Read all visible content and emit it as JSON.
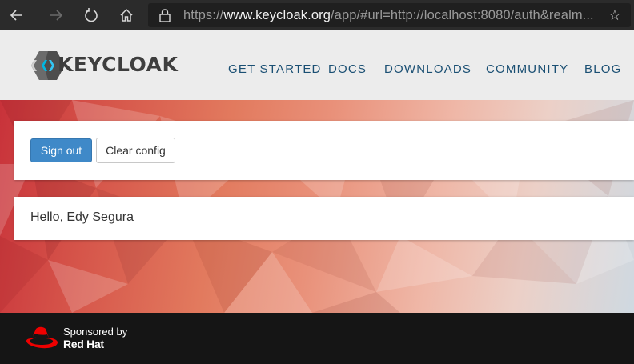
{
  "browser": {
    "url_prefix": "https://",
    "url_domain": "www.keycloak.org",
    "url_rest": "/app/#url=http://localhost:8080/auth&realm...",
    "icons": [
      "back-icon",
      "forward-icon",
      "refresh-icon",
      "home-icon",
      "lock-icon",
      "star-icon"
    ]
  },
  "header": {
    "logo_text": "KEYCLOAK",
    "nav": [
      "GET STARTED",
      "DOCS",
      "DOWNLOADS",
      "COMMUNITY",
      "BLOG"
    ]
  },
  "actions": {
    "sign_out_label": "Sign out",
    "clear_config_label": "Clear config"
  },
  "greeting": {
    "text": "Hello, Edy Segura"
  },
  "footer": {
    "sponsored_by": "Sponsored by",
    "brand": "Red Hat"
  },
  "colors": {
    "primary_button": "#3f89c8",
    "nav_link": "#1a4f73",
    "header_bg": "#ececec",
    "footer_bg": "#151515",
    "redhat_red": "#ee0000"
  }
}
